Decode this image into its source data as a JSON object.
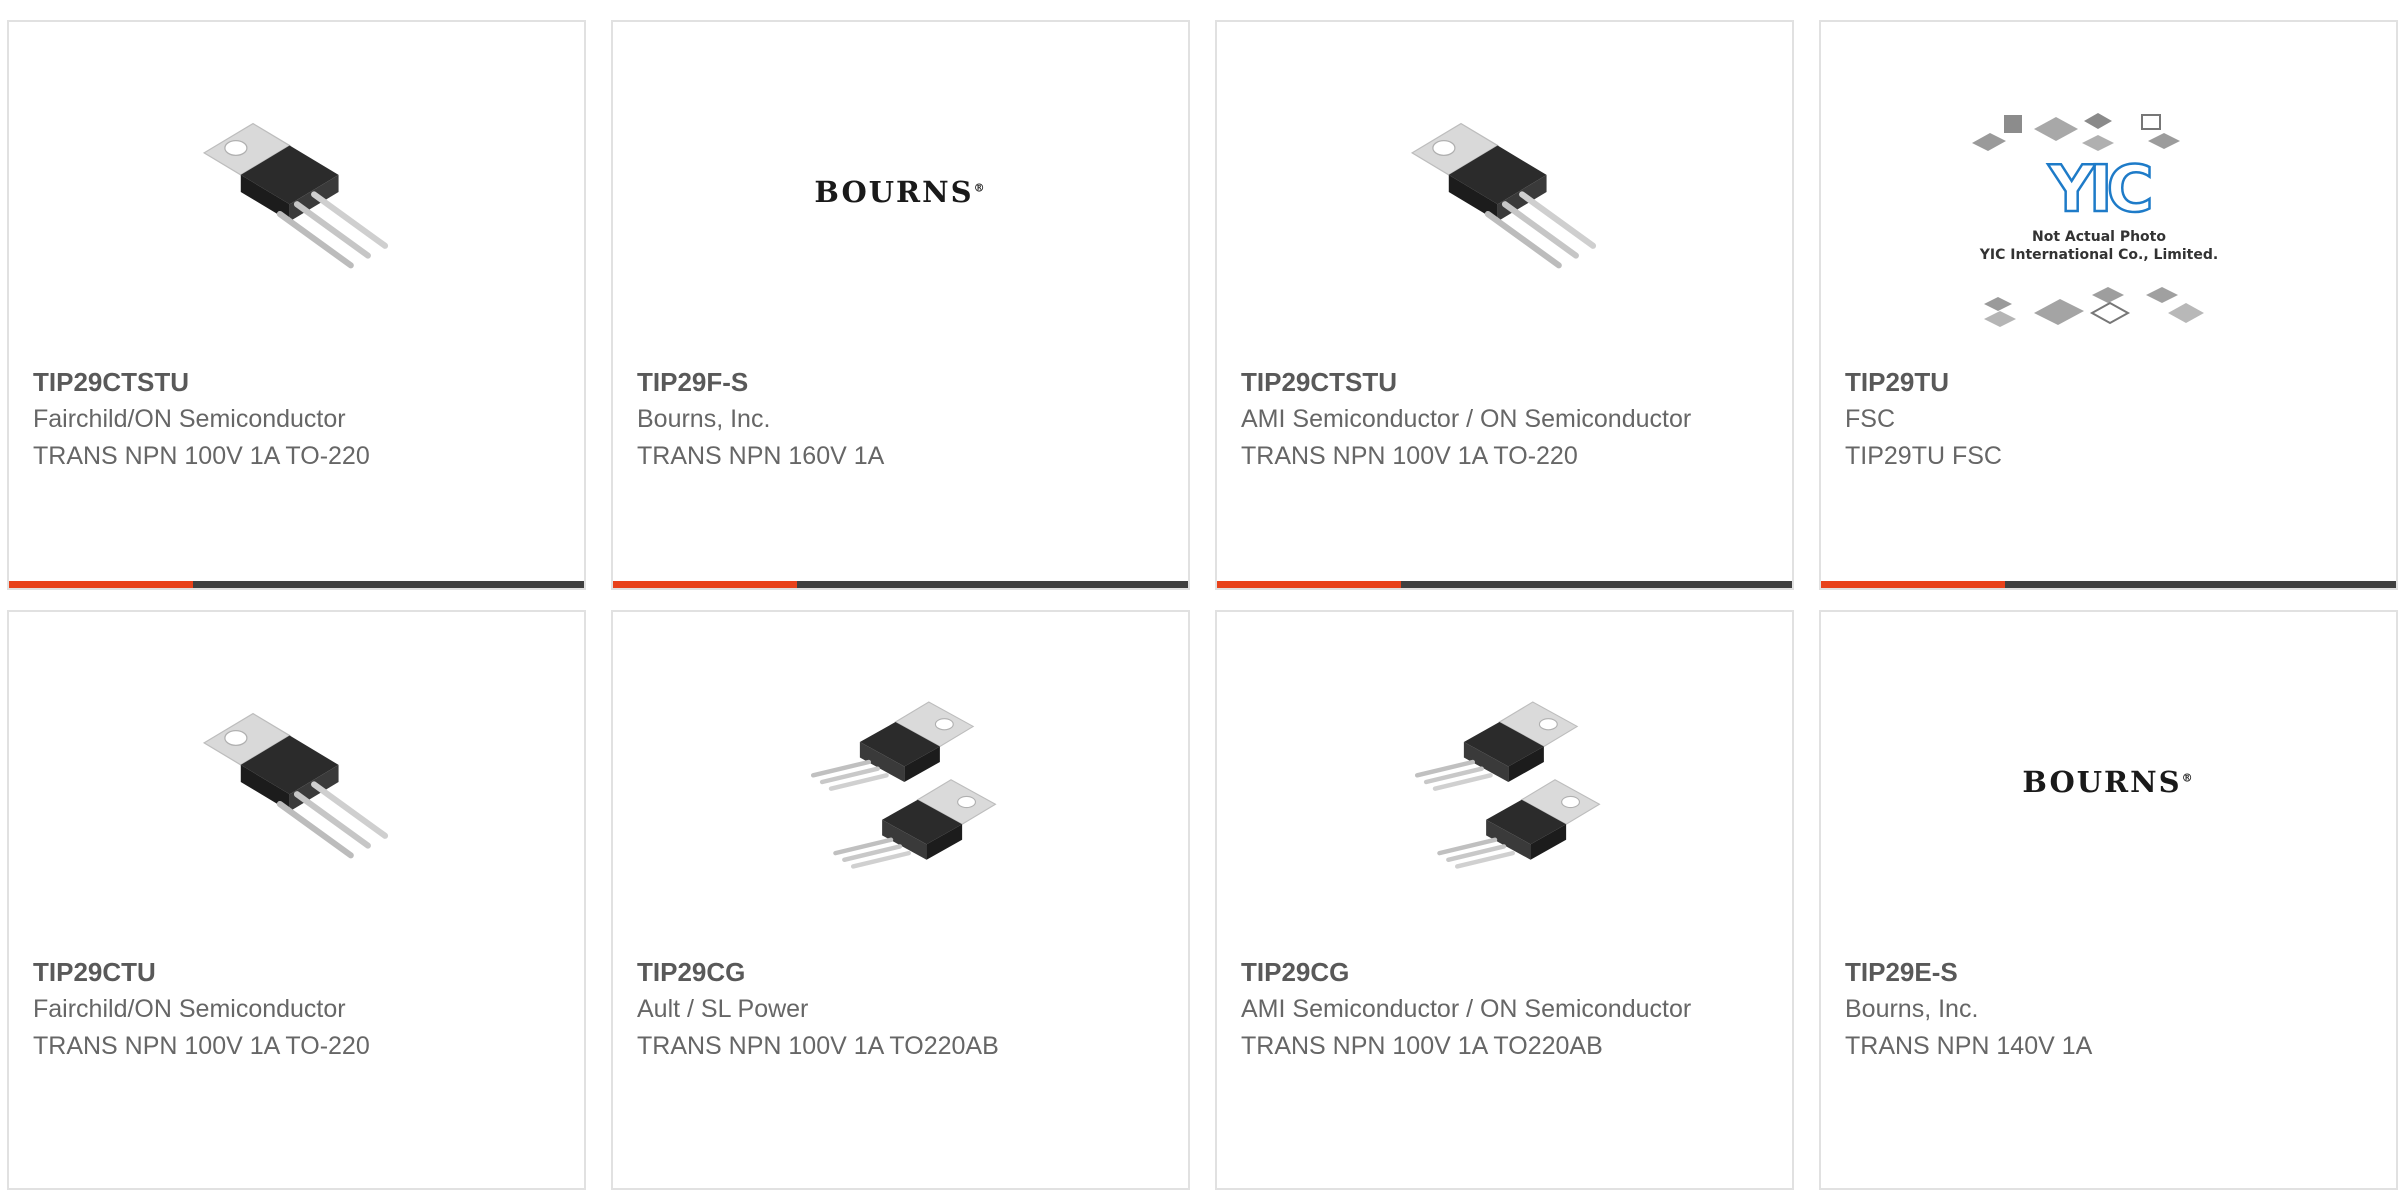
{
  "colors": {
    "accent": "#e8421b",
    "bar": "#404040",
    "text": "#666666"
  },
  "products": [
    {
      "part": "TIP29CTSTU",
      "manufacturer": "Fairchild/ON Semiconductor",
      "description": "TRANS NPN 100V 1A TO-220",
      "image": "to220-single-icon"
    },
    {
      "part": "TIP29F-S",
      "manufacturer": "Bourns, Inc.",
      "description": "TRANS NPN 160V 1A",
      "image": "bourns-logo",
      "logo_text": "BOURNS"
    },
    {
      "part": "TIP29CTSTU",
      "manufacturer": "AMI Semiconductor / ON Semiconductor",
      "description": "TRANS NPN 100V 1A TO-220",
      "image": "to220-single-icon"
    },
    {
      "part": "TIP29TU",
      "manufacturer": "FSC",
      "description": "TIP29TU FSC",
      "image": "yic-placeholder",
      "logo_text": "YIC",
      "placeholder_line1": "Not Actual Photo",
      "placeholder_line2": "YIC International Co., Limited."
    },
    {
      "part": "TIP29CTU",
      "manufacturer": "Fairchild/ON Semiconductor",
      "description": "TRANS NPN 100V 1A TO-220",
      "image": "to220-single-icon"
    },
    {
      "part": "TIP29CG",
      "manufacturer": "Ault / SL Power",
      "description": "TRANS NPN 100V 1A TO220AB",
      "image": "to220-pair-icon"
    },
    {
      "part": "TIP29CG",
      "manufacturer": "AMI Semiconductor / ON Semiconductor",
      "description": "TRANS NPN 100V 1A TO220AB",
      "image": "to220-pair-icon"
    },
    {
      "part": "TIP29E-S",
      "manufacturer": "Bourns, Inc.",
      "description": "TRANS NPN 140V 1A",
      "image": "bourns-logo",
      "logo_text": "BOURNS"
    }
  ]
}
